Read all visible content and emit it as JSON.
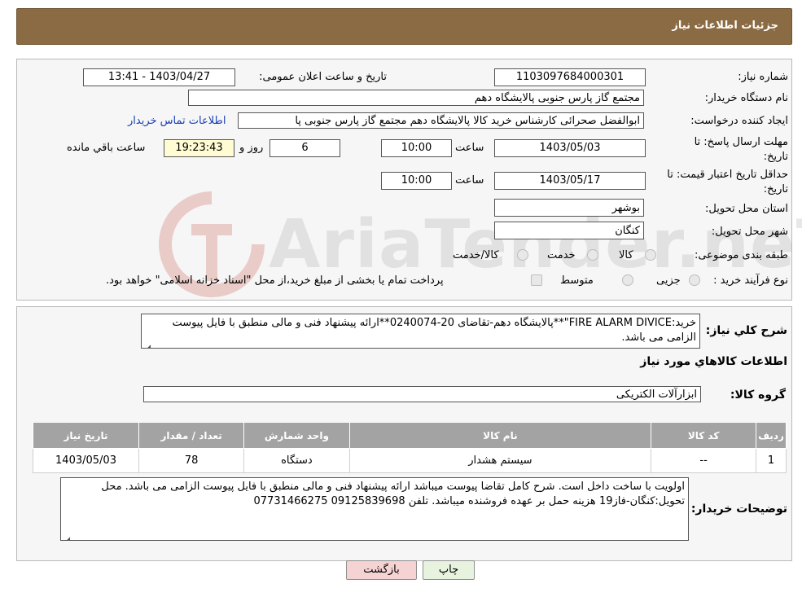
{
  "header": {
    "title": "جزئیات اطلاعات نیاز"
  },
  "form": {
    "need_number_label": "شماره نیاز:",
    "need_number": "1103097684000301",
    "announce_label": "تاریخ و ساعت اعلان عمومی:",
    "announce_value": "1403/04/27 - 13:41",
    "buyer_org_label": "نام دستگاه خریدار:",
    "buyer_org": "مجتمع گاز پارس جنوبی  پالایشگاه دهم",
    "creator_label": "ایجاد کننده درخواست:",
    "creator": "ابوالفضل صحرائی کارشناس خرید کالا پالایشگاه دهم مجتمع گاز پارس جنوبی  پا",
    "contact_link": "اطلاعات تماس خریدار",
    "reply_deadline_label_1": "مهلت ارسال پاسخ: تا",
    "reply_deadline_label_2": "تاریخ:",
    "reply_date": "1403/05/03",
    "time_label": "ساعت",
    "reply_time": "10:00",
    "days_value": "6",
    "days_label": "روز و",
    "remaining_time": "19:23:43",
    "remaining_label": "ساعت باقي مانده",
    "price_validity_label_1": "حداقل تاریخ اعتبار قیمت: تا",
    "price_validity_label_2": "تاریخ:",
    "price_date": "1403/05/17",
    "price_time_label": "ساعت",
    "price_time": "10:00",
    "province_label": "استان محل تحویل:",
    "province": "بوشهر",
    "city_label": "شهر محل تحویل:",
    "city": "کنگان",
    "category_label": "طبقه بندی موضوعی:",
    "category_options": [
      "کالا",
      "خدمت",
      "کالا/خدمت"
    ],
    "purchase_type_label": "نوع فرآیند خرید :",
    "purchase_options": [
      "جزیی",
      "متوسط"
    ],
    "purchase_note": "پرداخت تمام یا بخشی از مبلغ خرید،از محل \"اسناد خزانه اسلامی\" خواهد بود."
  },
  "watermark": {
    "text": "AriaTender.neT"
  },
  "summary": {
    "label": "شرح کلي نياز:",
    "text": "خرید:FIRE ALARM DIVICE\"**پالایشگاه دهم-تقاضای 20-0240074**ارائه پیشنهاد فنی و مالی منطبق با فایل پیوست الزامی می باشد."
  },
  "items_section": {
    "title": "اطلاعات کالاهاي مورد نياز",
    "group_label": "گروه کالا:",
    "group_value": "ابزارآلات الکتریکی"
  },
  "table": {
    "headers": [
      "ردیف",
      "کد کالا",
      "نام کالا",
      "واحد شمارش",
      "تعداد / مقدار",
      "تاریخ نیاز"
    ],
    "rows": [
      [
        "1",
        "--",
        "سیستم هشدار",
        "دستگاه",
        "78",
        "1403/05/03"
      ]
    ]
  },
  "buyer_notes": {
    "label": "توضیحات خریدار:",
    "text": "اولویت با ساخت داخل است. شرح کامل تقاضا پیوست میباشد ارائه پیشنهاد فنی و مالی منطبق با فایل پیوست الزامی می باشد. محل تحویل:کنگان-فاز19 هزینه حمل بر عهده فروشنده میباشد. تلفن 09125839698  07731466275"
  },
  "buttons": {
    "print": "چاپ",
    "back": "بازگشت"
  },
  "colors": {
    "header_bg": "#8b6b43",
    "table_header_bg": "#a3a3a3",
    "back_button_bg": "#f6d3d3",
    "print_button_bg": "#e7f3df"
  }
}
